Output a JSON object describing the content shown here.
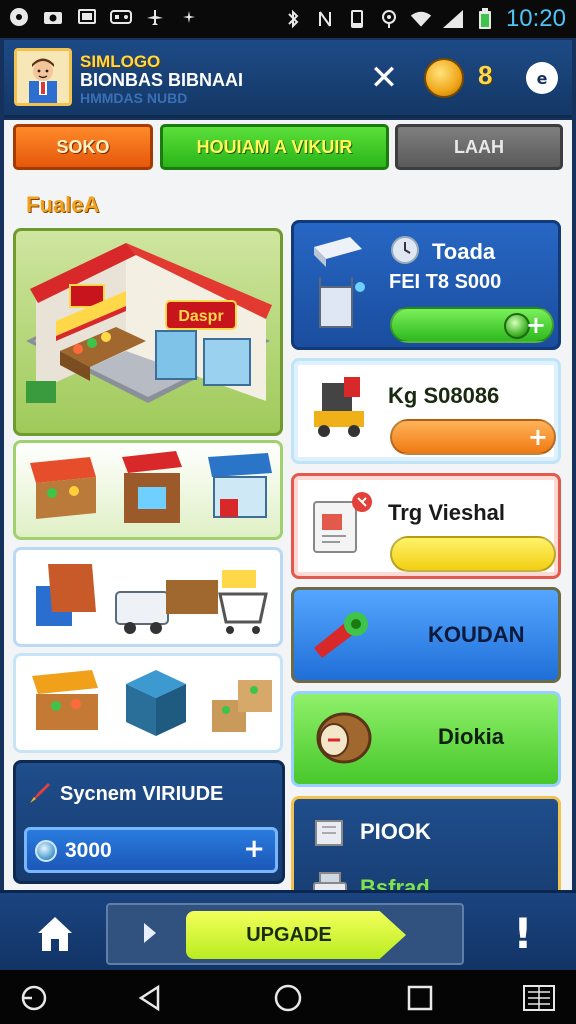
{
  "status_bar": {
    "time": "10:20",
    "icons": [
      "notification-dot-icon",
      "camera-icon",
      "cast-icon",
      "gamepad-icon",
      "plane-icon",
      "bluetooth-icon",
      "nfc-icon",
      "phone-icon",
      "location-icon",
      "wifi-icon",
      "signal-icon",
      "battery-icon"
    ]
  },
  "header": {
    "title_line1": "SIMLOGO",
    "title_line2": "BIONBAS BIBNAAI",
    "title_line3": "HMMDAS NUBD",
    "coin_count": "8",
    "info_label": "e"
  },
  "tabs": [
    {
      "label": "SOKO"
    },
    {
      "label": "HOUIAM A VIKUIR"
    },
    {
      "label": "LAAH"
    }
  ],
  "left": {
    "category_label": "FualeA",
    "shop_sign": "Daspr",
    "system_card": {
      "title": "Sycnem VIRIUDE",
      "value": "3000"
    }
  },
  "right": {
    "card1": {
      "title": "Toada",
      "subtitle": "FEI T8 S000"
    },
    "card2": {
      "title": "Kg S08086"
    },
    "card3": {
      "title": "Trg Vieshal"
    },
    "card4": {
      "title": "KOUDAN"
    },
    "card5": {
      "title": "Diokia"
    },
    "card6": {
      "title": "PIOOK",
      "subtitle": "Bsfrad"
    }
  },
  "bottom_nav": {
    "upgrade_label": "UPGADE"
  },
  "colors": {
    "frame": "#16315c",
    "accent_gold": "#ffd84a",
    "tab_orange": "#e5580c",
    "tab_green": "#2bb51a",
    "tab_gray": "#5a5a5a",
    "clock": "#4fc3f7"
  }
}
